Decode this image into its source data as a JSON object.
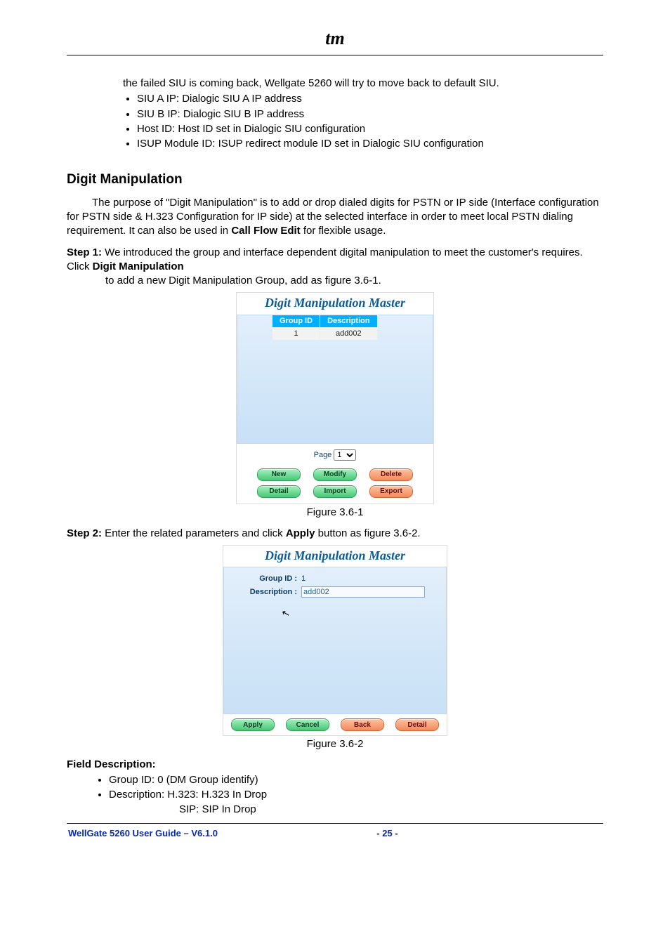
{
  "logo": "tm",
  "top_para": "the failed SIU is coming back, Wellgate 5260 will try to move back to default SIU.",
  "top_bullets": [
    "SIU A IP: Dialogic SIU A IP address",
    "SIU B IP: Dialogic SIU B IP address",
    "Host ID: Host ID set in Dialogic SIU configuration",
    "ISUP Module ID: ISUP redirect module ID set in Dialogic SIU configuration"
  ],
  "heading": "Digit Manipulation",
  "digit_para": "The purpose of \"Digit Manipulation\" is to add or drop dialed digits for PSTN or IP side (Interface configuration for PSTN side & H.323 Configuration for IP side) at the selected interface in order to meet local PSTN dialing requirement. It can also be used in ",
  "digit_para_bold": "Call Flow Edit",
  "digit_para_tail": " for flexible usage.",
  "step1": {
    "label": "Step 1:",
    "t1": " We introduced the group and interface dependent digital manipulation to meet the customer's requires. Click ",
    "bold": "Digit Manipulation",
    "t2": " to add a new Digit Manipulation Group, add as figure 3.6-1."
  },
  "shot1": {
    "title": "Digit Manipulation Master",
    "th1": "Group ID",
    "th2": "Description",
    "td1": "1",
    "td2": "add002",
    "page_label": "Page",
    "page_val": "1",
    "btns": [
      "New",
      "Modify",
      "Delete",
      "Detail",
      "Import",
      "Export"
    ]
  },
  "fig1_caption": "Figure 3.6-1",
  "step2": {
    "label": "Step 2:",
    "t1": " Enter the related parameters and click ",
    "bold": "Apply",
    "t2": " button as figure 3.6-2."
  },
  "shot2": {
    "title": "Digit Manipulation Master",
    "group_lbl": "Group ID :",
    "group_val": "1",
    "desc_lbl": "Description :",
    "desc_val": "add002",
    "btns": [
      "Apply",
      "Cancel",
      "Back",
      "Detail"
    ]
  },
  "fig2_caption": "Figure 3.6-2",
  "field_desc_head": "Field Description:",
  "field_bullets": [
    "Group ID: 0 (DM Group identify)",
    "Description:  H.323: H.323 In Drop"
  ],
  "field_desc_sip": "SIP: SIP In Drop",
  "footer_left": "WellGate 5260 User Guide – V6.1.0",
  "footer_page": "- 25 -"
}
